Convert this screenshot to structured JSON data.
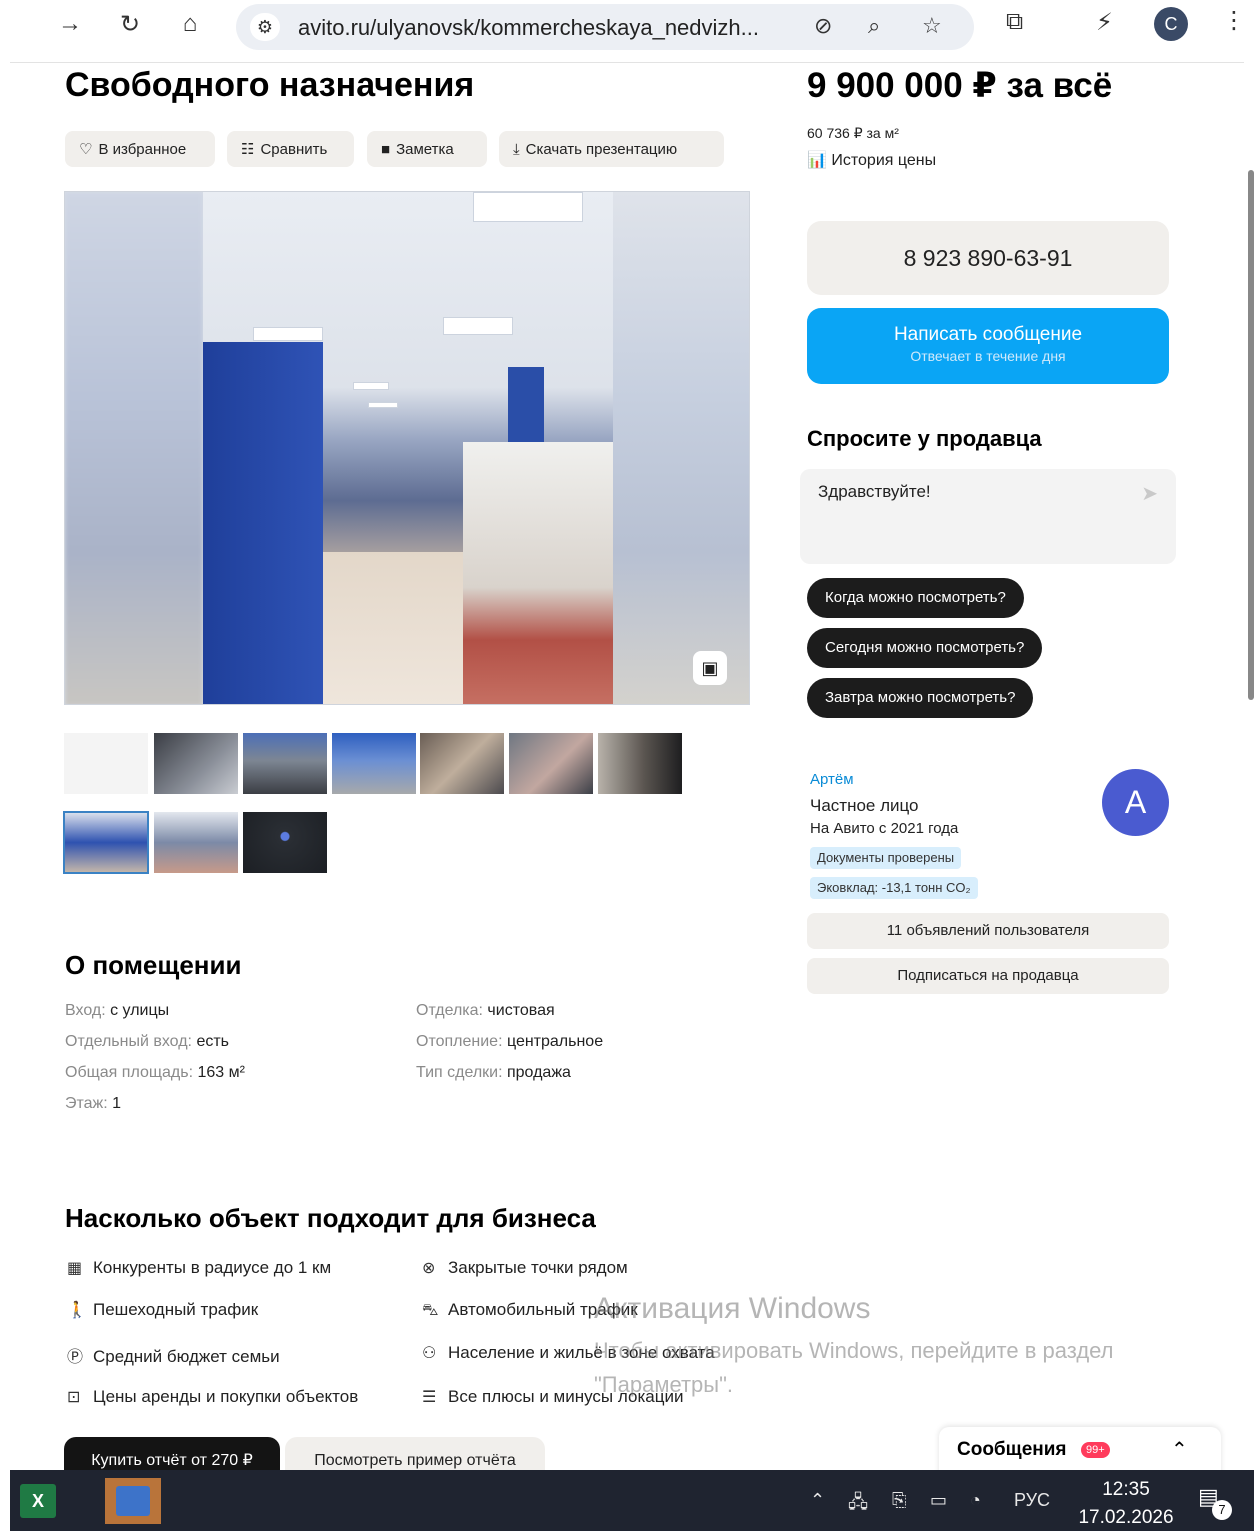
{
  "browser": {
    "url": "avito.ru/ulyanovsk/kommercheskaya_nedvizh...",
    "profile_initial": "C"
  },
  "listing": {
    "title": "Свободного назначения",
    "price": "9 900 000 ₽ за всё",
    "price_per_m2": "60 736 ₽ за м²",
    "price_history": "История цены",
    "actions": {
      "favorite": "В избранное",
      "compare": "Сравнить",
      "note": "Заметка",
      "download": "Скачать презентацию"
    }
  },
  "contact": {
    "phone": "8 923 890-63-91",
    "message_label": "Написать сообщение",
    "message_sub": "Отвечает в течение дня",
    "ask_title": "Спросите у продавца",
    "ask_text": "Здравствуйте!",
    "quick_questions": [
      "Когда можно посмотреть?",
      "Сегодня можно посмотреть?",
      "Завтра можно посмотреть?"
    ]
  },
  "seller": {
    "name": "Артём",
    "type": "Частное лицо",
    "since": "На Авито с 2021 года",
    "avatar_letter": "А",
    "badges": [
      "Документы проверены",
      "Эковклад: -13,1 тонн CO₂"
    ],
    "ads_button": "11 объявлений пользователя",
    "subscribe_button": "Подписаться на продавца"
  },
  "about": {
    "title": "О помещении",
    "left": [
      {
        "k": "Вход: ",
        "v": "с улицы"
      },
      {
        "k": "Отдельный вход: ",
        "v": "есть"
      },
      {
        "k": "Общая площадь: ",
        "v": "163 м²"
      },
      {
        "k": "Этаж: ",
        "v": "1"
      }
    ],
    "right": [
      {
        "k": "Отделка: ",
        "v": "чистовая"
      },
      {
        "k": "Отопление: ",
        "v": "центральное"
      },
      {
        "k": "Тип сделки: ",
        "v": "продажа"
      }
    ]
  },
  "business": {
    "title": "Насколько объект подходит для бизнеса",
    "left": [
      {
        "icon": "building-icon",
        "label": "Конкуренты в радиусе до 1 км"
      },
      {
        "icon": "walk-icon",
        "label": "Пешеходный трафик"
      },
      {
        "icon": "coin-icon",
        "label": "Средний бюджет семьи"
      },
      {
        "icon": "chart-icon",
        "label": "Цены аренды и покупки объектов"
      }
    ],
    "right": [
      {
        "icon": "closed-icon",
        "label": "Закрытые точки рядом"
      },
      {
        "icon": "car-icon",
        "label": "Автомобильный трафик"
      },
      {
        "icon": "people-icon",
        "label": "Население и жильё в зоне охвата"
      },
      {
        "icon": "list-icon",
        "label": "Все плюсы и минусы локации"
      }
    ],
    "buy_report": "Купить отчёт от 270 ₽",
    "sample_report": "Посмотреть пример отчёта"
  },
  "messages_bar": {
    "label": "Сообщения",
    "badge": "99+"
  },
  "watermark": {
    "line1": "Активация Windows",
    "line2": "Чтобы активировать Windows, перейдите в раздел",
    "line3": "\"Параметры\"."
  },
  "taskbar": {
    "lang": "РУС",
    "time": "12:35",
    "date": "17.02.2026",
    "notifications": "7"
  }
}
